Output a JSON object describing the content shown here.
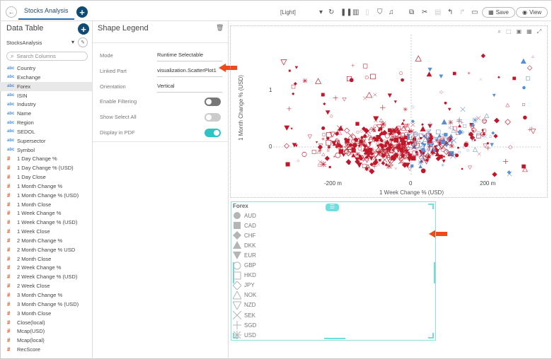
{
  "topbar": {
    "tab": "Stocks Analysis",
    "theme": "[Light]",
    "save": "Save",
    "view": "View"
  },
  "left": {
    "title": "Data Table",
    "source": "StocksAnalysis",
    "search_placeholder": "Search Columns",
    "columns": [
      {
        "type": "abc",
        "name": "Country"
      },
      {
        "type": "abc",
        "name": "Exchange"
      },
      {
        "type": "abc",
        "name": "Forex",
        "selected": true
      },
      {
        "type": "abc",
        "name": "ISIN"
      },
      {
        "type": "abc",
        "name": "Industry"
      },
      {
        "type": "abc",
        "name": "Name"
      },
      {
        "type": "abc",
        "name": "Region"
      },
      {
        "type": "abc",
        "name": "SEDOL"
      },
      {
        "type": "abc",
        "name": "Supersector"
      },
      {
        "type": "abc",
        "name": "Symbol"
      },
      {
        "type": "#",
        "name": "1 Day Change %"
      },
      {
        "type": "#",
        "name": "1 Day Change % (USD)"
      },
      {
        "type": "#",
        "name": "1 Day Close"
      },
      {
        "type": "#",
        "name": "1 Month Change %"
      },
      {
        "type": "#",
        "name": "1 Month Change % (USD)"
      },
      {
        "type": "#",
        "name": "1 Month Close"
      },
      {
        "type": "#",
        "name": "1 Week Change %"
      },
      {
        "type": "#",
        "name": "1 Week Change % (USD)"
      },
      {
        "type": "#",
        "name": "1 Week Close"
      },
      {
        "type": "#",
        "name": "2 Month Change %"
      },
      {
        "type": "#",
        "name": "2 Month Change % USD"
      },
      {
        "type": "#",
        "name": "2 Month Close"
      },
      {
        "type": "#",
        "name": "2 Week Change %"
      },
      {
        "type": "#",
        "name": "2 Week Change % (USD)"
      },
      {
        "type": "#",
        "name": "2 Week Close"
      },
      {
        "type": "#",
        "name": "3 Month Change %"
      },
      {
        "type": "#",
        "name": "3 Month Change % (USD)"
      },
      {
        "type": "#",
        "name": "3 Month Close"
      },
      {
        "type": "#",
        "name": "Close(local)"
      },
      {
        "type": "#",
        "name": "Mcap(USD)"
      },
      {
        "type": "#",
        "name": "Mcap(local)"
      },
      {
        "type": "#",
        "name": "RecScore"
      }
    ]
  },
  "mid": {
    "title": "Shape Legend",
    "props": [
      {
        "label": "Mode",
        "value": "Runtime Selectable"
      },
      {
        "label": "Linked Part",
        "value": "visualization.ScatterPlot1"
      },
      {
        "label": "Orientation",
        "value": "Vertical"
      }
    ],
    "toggles": [
      {
        "label": "Enable Filtering",
        "state": "off-dark"
      },
      {
        "label": "Show Select All",
        "state": "off"
      },
      {
        "label": "Display in PDF",
        "state": "on"
      }
    ]
  },
  "plot": {
    "xlabel": "1 Week Change % (USD)",
    "ylabel": "1 Month Change % (USD)",
    "xticks": [
      "-200 m",
      "0",
      "200 m"
    ],
    "yticks": [
      "1",
      "0"
    ],
    "colors": {
      "red": "#c0182a",
      "blue": "#5b8fd0"
    }
  },
  "legend": {
    "title": "Forex",
    "items": [
      {
        "label": "AUD",
        "shape": "circle"
      },
      {
        "label": "CAD",
        "shape": "square"
      },
      {
        "label": "CHF",
        "shape": "diamond"
      },
      {
        "label": "DKK",
        "shape": "triangle-up"
      },
      {
        "label": "EUR",
        "shape": "triangle-down"
      },
      {
        "label": "GBP",
        "shape": "circle-open"
      },
      {
        "label": "HKD",
        "shape": "square-open"
      },
      {
        "label": "JPY",
        "shape": "diamond-open"
      },
      {
        "label": "NOK",
        "shape": "triangle-up-open"
      },
      {
        "label": "NZD",
        "shape": "triangle-down-open"
      },
      {
        "label": "SEK",
        "shape": "cross"
      },
      {
        "label": "SGD",
        "shape": "plus"
      },
      {
        "label": "USD",
        "shape": "star"
      }
    ]
  }
}
